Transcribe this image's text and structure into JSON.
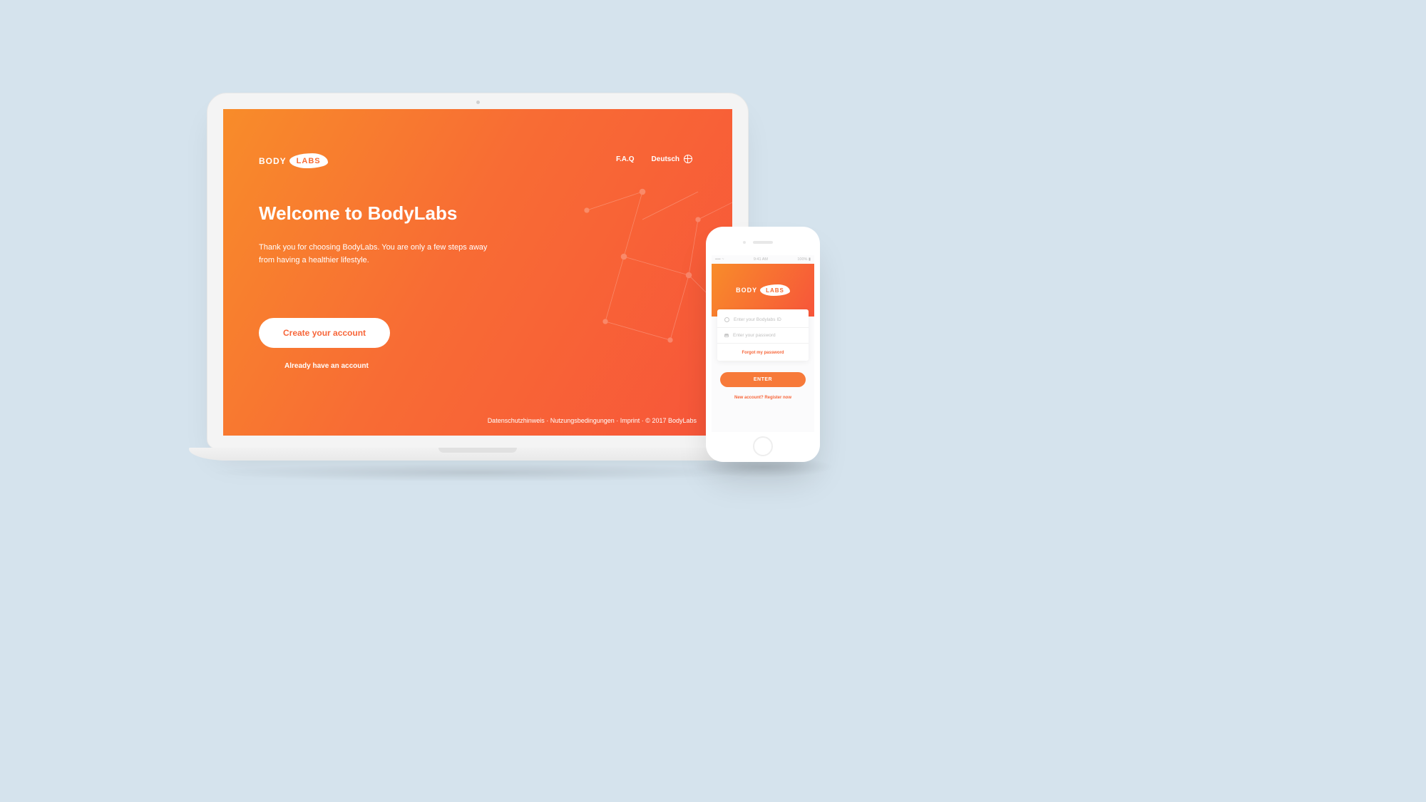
{
  "brand": {
    "part1": "BODY",
    "part2": "LABS"
  },
  "laptop": {
    "nav": {
      "faq": "F.A.Q",
      "language": "Deutsch"
    },
    "hero": {
      "title": "Welcome to BodyLabs",
      "subtitle": "Thank you for choosing BodyLabs. You are only a few steps away from having a healthier lifestyle."
    },
    "cta": {
      "primary": "Create your account",
      "secondary": "Already have an account"
    },
    "footer": "Datenschutzhinweis · Nutzungsbedingungen · Imprint · © 2017 BodyLabs"
  },
  "phone": {
    "status": {
      "carrier": "•••• ~",
      "time": "9:41 AM",
      "battery": "100% ▮"
    },
    "fields": {
      "id_placeholder": "Enter your Bodylabs ID",
      "password_placeholder": "Enter your password"
    },
    "forgot": "Forgot my password",
    "enter": "ENTER",
    "register_prompt": "New account? ",
    "register_link": "Register now"
  }
}
